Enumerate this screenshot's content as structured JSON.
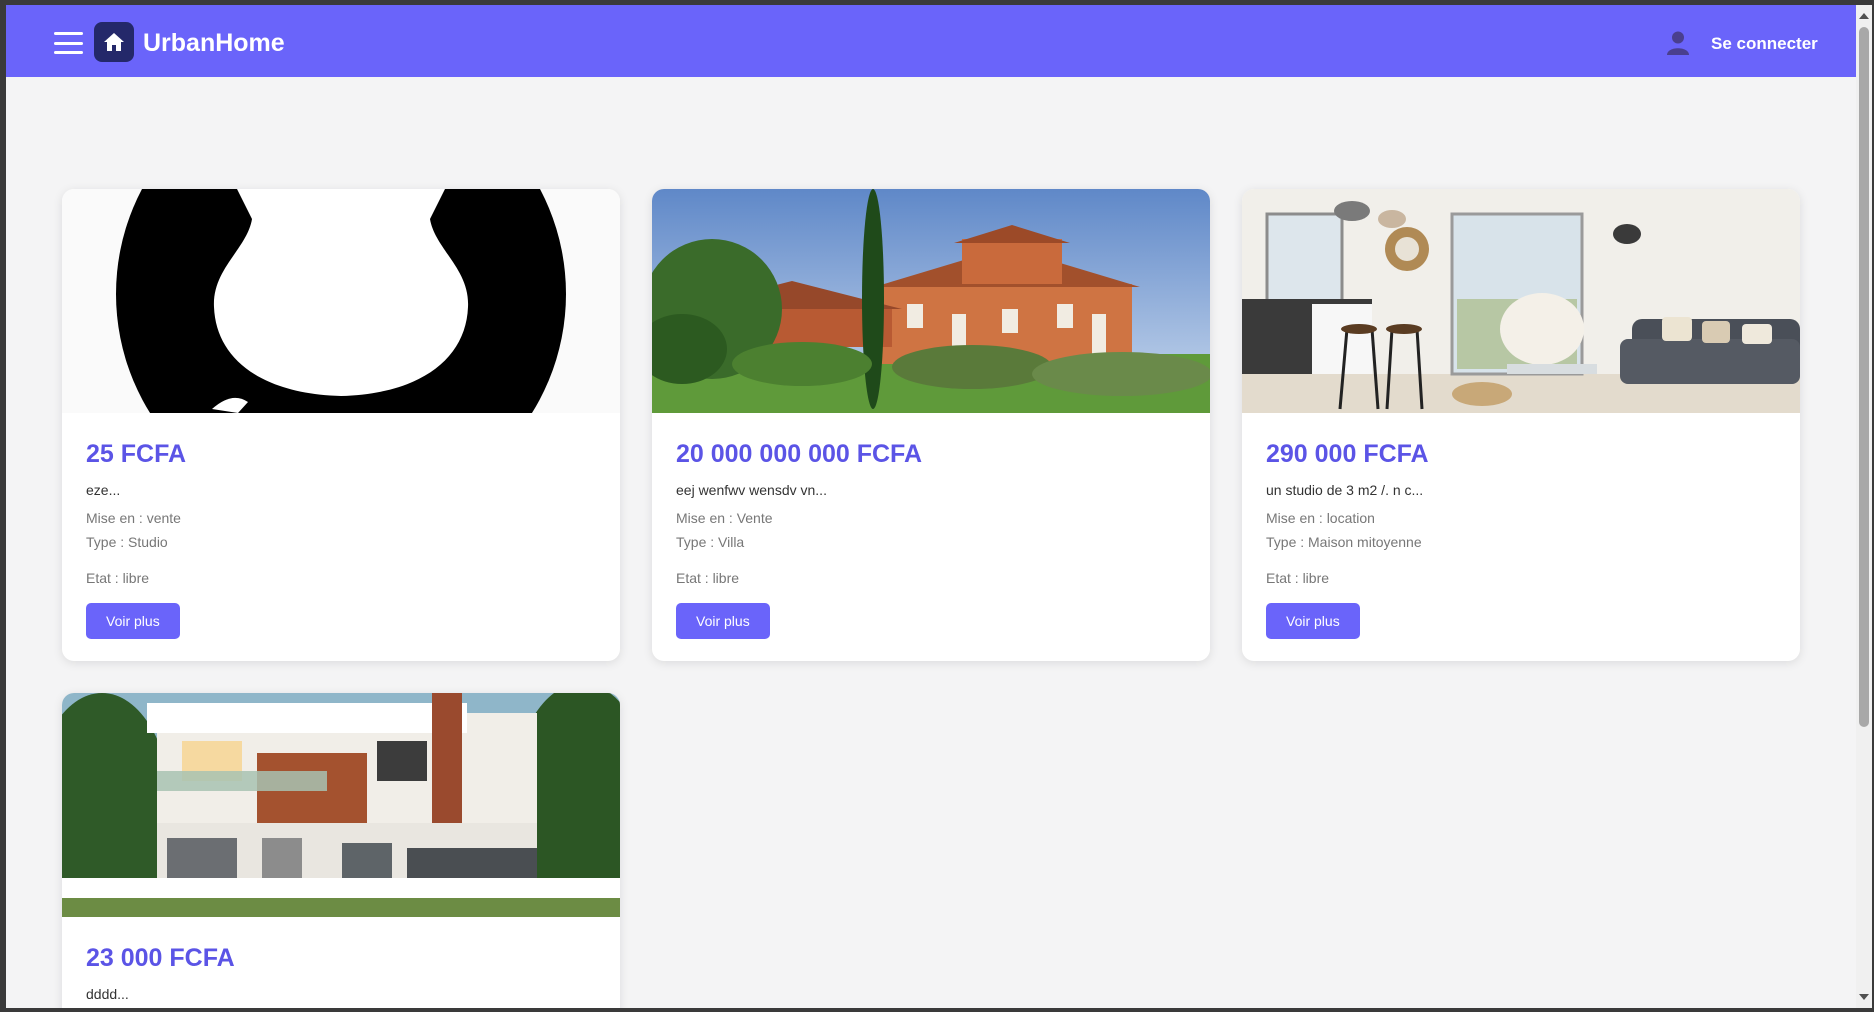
{
  "header": {
    "brand": "UrbanHome",
    "login_label": "Se connecter",
    "menu_icon": "hamburger-menu-icon",
    "logo_icon": "home-icon",
    "user_icon": "user-icon",
    "background_color": "#6a64fa"
  },
  "listings": [
    {
      "price": "25 FCFA",
      "description": "eze...",
      "mise_en": "Mise en : vente",
      "type": "Type : Studio",
      "etat": "Etat : libre",
      "button_label": "Voir plus"
    },
    {
      "price": "20 000 000 000 FCFA",
      "description": "eej wenfwv wensdv vn...",
      "mise_en": "Mise en : Vente",
      "type": "Type : Villa",
      "etat": "Etat : libre",
      "button_label": "Voir plus"
    },
    {
      "price": "290 000 FCFA",
      "description": "un studio de 3 m2 /. n c...",
      "mise_en": "Mise en : location",
      "type": "Type : Maison mitoyenne",
      "etat": "Etat : libre",
      "button_label": "Voir plus"
    },
    {
      "price": "23 000 FCFA",
      "description": "dddd..."
    }
  ],
  "colors": {
    "accent": "#6a64fa",
    "price": "#5b54e6",
    "page_background": "#f4f4f5"
  }
}
